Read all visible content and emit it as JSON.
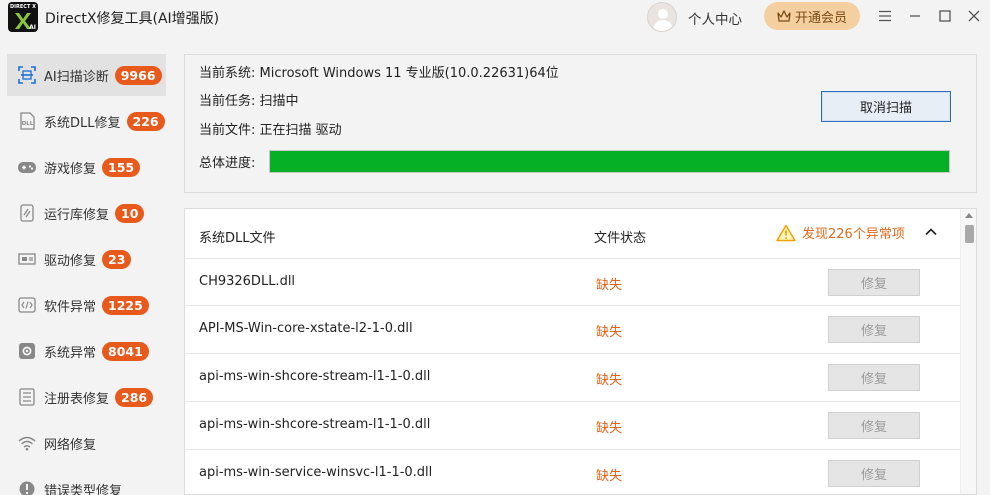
{
  "window": {
    "title": "DirectX修复工具(AI增强版)",
    "logo_top": "DIRECT X",
    "logo_badge": "AI",
    "user_center": "个人中心",
    "vip_label": "开通会员",
    "controls": [
      "menu-icon",
      "minimize-icon",
      "maximize-icon",
      "close-icon"
    ]
  },
  "sidebar": {
    "items": [
      {
        "label": "AI扫描诊断",
        "badge": "9966",
        "icon": "scan-icon",
        "active": true
      },
      {
        "label": "系统DLL修复",
        "badge": "226",
        "icon": "dll-icon"
      },
      {
        "label": "游戏修复",
        "badge": "155",
        "icon": "gamepad-icon"
      },
      {
        "label": "运行库修复",
        "badge": "10",
        "icon": "runtime-icon"
      },
      {
        "label": "驱动修复",
        "badge": "23",
        "icon": "driver-icon"
      },
      {
        "label": "软件异常",
        "badge": "1225",
        "icon": "code-icon"
      },
      {
        "label": "系统异常",
        "badge": "8041",
        "icon": "gear-icon"
      },
      {
        "label": "注册表修复",
        "badge": "286",
        "icon": "registry-icon"
      },
      {
        "label": "网络修复",
        "badge": "",
        "icon": "wifi-icon"
      },
      {
        "label": "错误类型修复",
        "badge": "",
        "icon": "error-icon"
      }
    ]
  },
  "status": {
    "system_label": "当前系统:",
    "system_value": "Microsoft Windows 11 专业版(10.0.22631)64位",
    "task_label": "当前任务:",
    "task_value": "扫描中",
    "file_label": "当前文件:",
    "file_value": "正在扫描 驱动",
    "progress_label": "总体进度:",
    "progress": 1.0,
    "progress_color": "#06b025",
    "cancel_label": "取消扫描"
  },
  "list": {
    "col_file": "系统DLL文件",
    "col_status": "文件状态",
    "warning": "发现226个异常项",
    "fix_label": "修复",
    "rows": [
      {
        "file": "CH9326DLL.dll",
        "status": "缺失"
      },
      {
        "file": "API-MS-Win-core-xstate-l2-1-0.dll",
        "status": "缺失"
      },
      {
        "file": "api-ms-win-shcore-stream-l1-1-0.dll",
        "status": "缺失"
      },
      {
        "file": "api-ms-win-shcore-stream-l1-1-0.dll",
        "status": "缺失"
      },
      {
        "file": "api-ms-win-service-winsvc-l1-1-0.dll",
        "status": "缺失"
      }
    ]
  },
  "colors": {
    "accent": "#1a6fd6",
    "badge": "#e85a1c",
    "missing": "#e0631c",
    "vip": "#f4cf9f"
  }
}
